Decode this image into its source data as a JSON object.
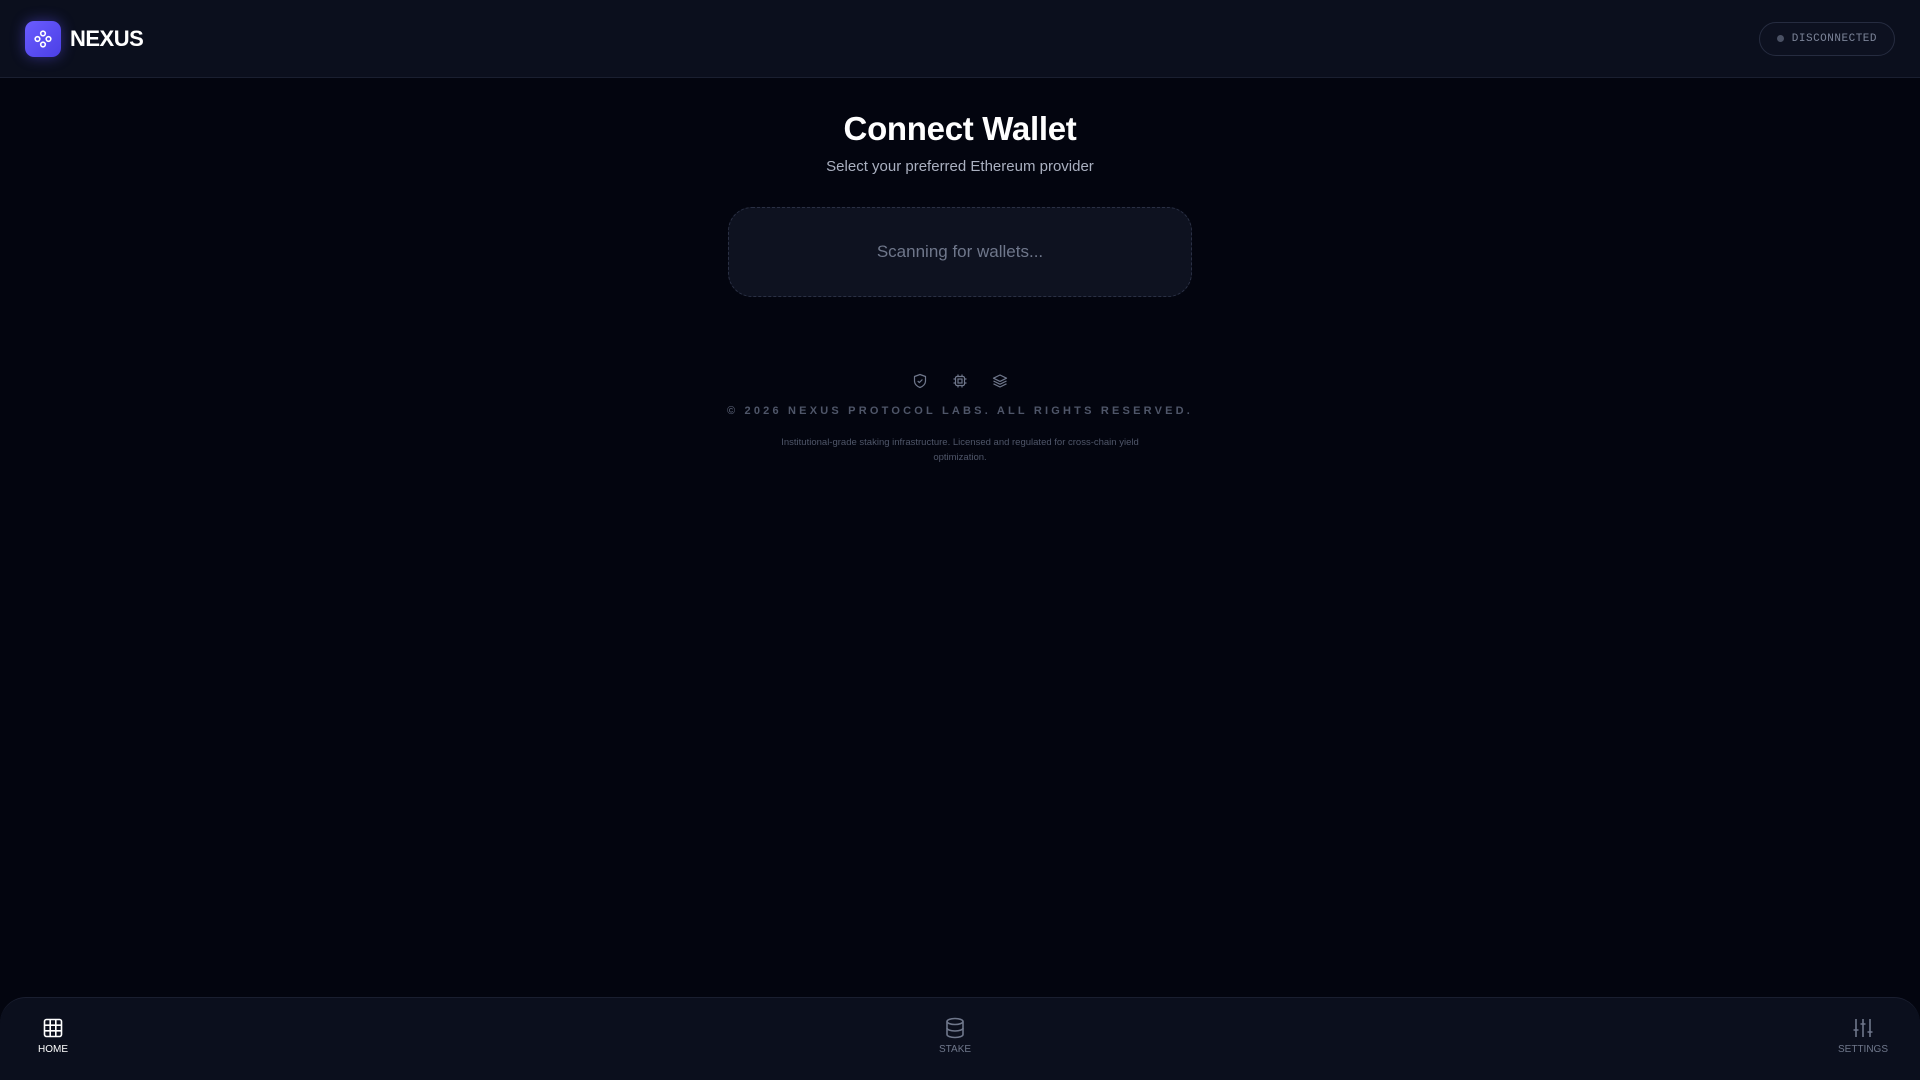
{
  "header": {
    "brand_name": "NEXUS",
    "logo_icon": "nodes-icon",
    "status": {
      "label": "DISCONNECTED",
      "dot_color": "#4a5164"
    }
  },
  "main": {
    "title": "Connect Wallet",
    "subtitle": "Select your preferred Ethereum provider",
    "scan_text": "Scanning for wallets..."
  },
  "footer": {
    "icons": [
      "shield-check-icon",
      "chip-icon",
      "layers-icon"
    ],
    "copyright": "© 2026 NEXUS PROTOCOL LABS. ALL RIGHTS RESERVED.",
    "disclaimer": "Institutional-grade staking infrastructure. Licensed and regulated for cross-chain yield optimization."
  },
  "nav": {
    "items": [
      {
        "label": "HOME",
        "icon": "grid-icon",
        "active": true
      },
      {
        "label": "STAKE",
        "icon": "database-icon",
        "active": false
      },
      {
        "label": "SETTINGS",
        "icon": "sliders-icon",
        "active": false
      }
    ]
  },
  "colors": {
    "background": "#03050f",
    "accent": "#6254ff",
    "header_bg": "#0b0f1d"
  }
}
